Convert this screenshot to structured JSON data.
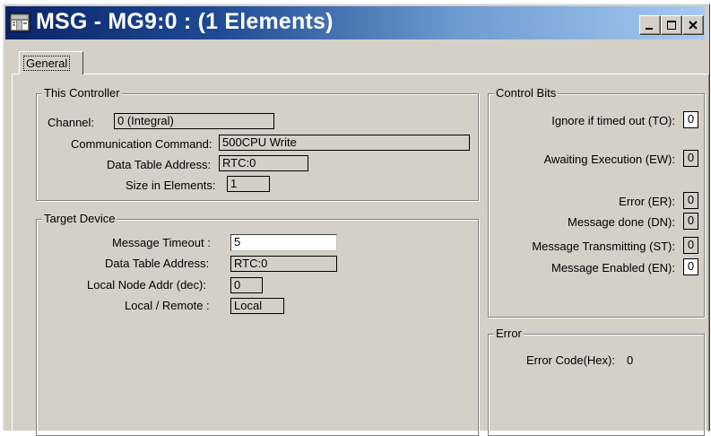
{
  "window": {
    "title": "MSG - MG9:0 : (1 Elements)",
    "buttons": {
      "minimize": "minimize",
      "maximize": "maximize",
      "close": "close"
    }
  },
  "tabs": [
    {
      "label": "General",
      "active": true
    }
  ],
  "this_controller": {
    "title": "This Controller",
    "channel_label": "Channel:",
    "channel_value": "0 (Integral)",
    "comm_command_label": "Communication Command:",
    "comm_command_value": "500CPU Write",
    "data_table_label": "Data Table Address:",
    "data_table_value": "RTC:0",
    "size_label": "Size in Elements:",
    "size_value": "1"
  },
  "target_device": {
    "title": "Target Device",
    "timeout_label": "Message Timeout :",
    "timeout_value": "5",
    "data_table_label": "Data Table Address:",
    "data_table_value": "RTC:0",
    "local_node_label": "Local Node Addr (dec):",
    "local_node_value": "0",
    "local_remote_label": "Local / Remote :",
    "local_remote_value": "Local"
  },
  "control_bits": {
    "title": "Control Bits",
    "items": [
      {
        "label": "Ignore if timed out (TO):",
        "value": "0"
      },
      {
        "label": "Awaiting Execution (EW):",
        "value": "0"
      },
      {
        "label": "Error (ER):",
        "value": "0"
      },
      {
        "label": "Message done (DN):",
        "value": "0"
      },
      {
        "label": "Message Transmitting (ST):",
        "value": "0"
      },
      {
        "label": "Message Enabled (EN):",
        "value": "0"
      }
    ]
  },
  "error": {
    "title": "Error",
    "code_label": "Error Code(Hex):",
    "code_value": "0"
  },
  "colors": {
    "title_start": "#0a246a",
    "title_end": "#a6caf0",
    "face": "#d4d0c8"
  }
}
